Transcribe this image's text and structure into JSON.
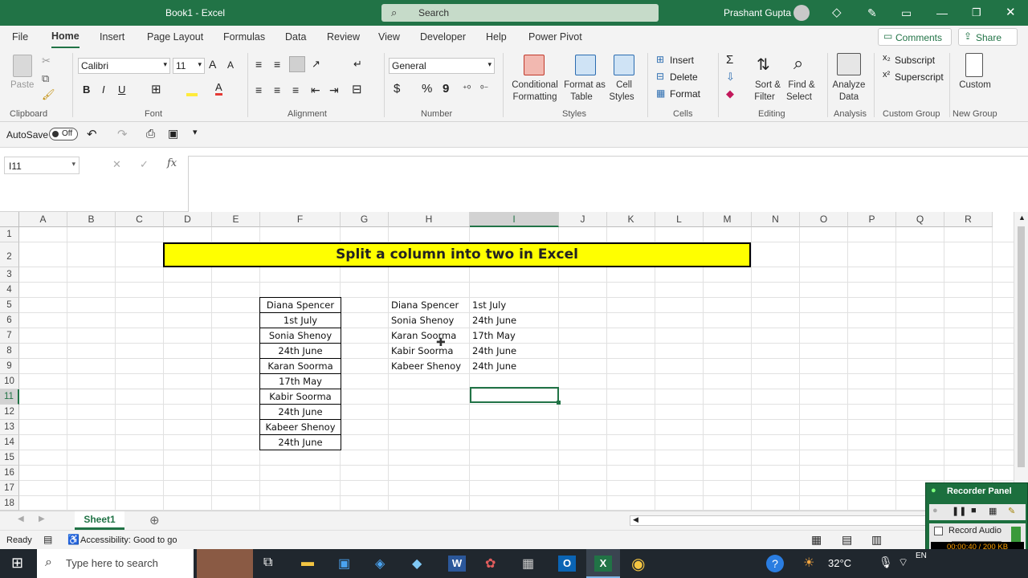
{
  "window": {
    "title": "Book1  -  Excel",
    "user": "Prashant Gupta"
  },
  "search": {
    "placeholder": "Search"
  },
  "tabs": [
    "File",
    "Home",
    "Insert",
    "Page Layout",
    "Formulas",
    "Data",
    "Review",
    "View",
    "Developer",
    "Help",
    "Power Pivot"
  ],
  "header_buttons": {
    "comments": "Comments",
    "share": "Share"
  },
  "ribbon": {
    "clipboard": {
      "paste": "Paste",
      "group": "Clipboard"
    },
    "font": {
      "name": "Calibri",
      "size": "11",
      "group": "Font",
      "bold": "B",
      "italic": "I",
      "underline": "U",
      "grow": "A",
      "shrink": "A"
    },
    "alignment": {
      "group": "Alignment"
    },
    "number": {
      "format": "General",
      "group": "Number",
      "currency": "$",
      "percent": "%",
      "comma": "9"
    },
    "styles": {
      "conditional": "Conditional",
      "conditional2": "Formatting",
      "format_as": "Format as",
      "format_as2": "Table",
      "cell": "Cell",
      "cell2": "Styles",
      "group": "Styles"
    },
    "cells": {
      "insert": "Insert",
      "delete": "Delete",
      "format": "Format",
      "group": "Cells"
    },
    "editing": {
      "sort": "Sort &",
      "sort2": "Filter",
      "find": "Find &",
      "find2": "Select",
      "group": "Editing"
    },
    "analysis": {
      "analyze": "Analyze",
      "analyze2": "Data",
      "group": "Analysis"
    },
    "custom_group": {
      "subscript": "Subscript",
      "superscript": "Superscript",
      "group": "Custom Group"
    },
    "new_group": {
      "custom": "Custom",
      "group": "New Group"
    }
  },
  "qat": {
    "autosave": "AutoSave",
    "toggle": "Off"
  },
  "formula_bar": {
    "name_box": "I11",
    "fx": "fx",
    "content": ""
  },
  "columns": [
    "A",
    "B",
    "C",
    "D",
    "E",
    "F",
    "G",
    "H",
    "I",
    "J",
    "K",
    "L",
    "M",
    "N",
    "O",
    "P",
    "Q",
    "R"
  ],
  "rows": [
    "1",
    "2",
    "3",
    "4",
    "5",
    "6",
    "7",
    "8",
    "9",
    "10",
    "11",
    "12",
    "13",
    "14",
    "15",
    "16",
    "17",
    "18"
  ],
  "banner": "Split a column into two in Excel",
  "column_f": [
    "Diana Spencer",
    "1st July",
    "Sonia Shenoy",
    "24th June",
    "Karan Soorma",
    "17th May",
    "Kabir Soorma",
    "24th June",
    "Kabeer Shenoy",
    "24th June"
  ],
  "column_h": [
    "Diana Spencer",
    "Sonia Shenoy",
    "Karan Soorma",
    "Kabir Soorma",
    "Kabeer Shenoy"
  ],
  "column_i": [
    "1st July",
    "24th June",
    "17th May",
    "24th June",
    "24th June"
  ],
  "sheet": {
    "name": "Sheet1"
  },
  "status": {
    "ready": "Ready",
    "accessibility": "Accessibility: Good to go"
  },
  "taskbar": {
    "search": "Type here to search",
    "temp": "32°C",
    "lang": "EN"
  },
  "recorder": {
    "title": "Recorder Panel",
    "record_audio": "Record Audio",
    "counter": "00:00:40 / 200 KB"
  }
}
